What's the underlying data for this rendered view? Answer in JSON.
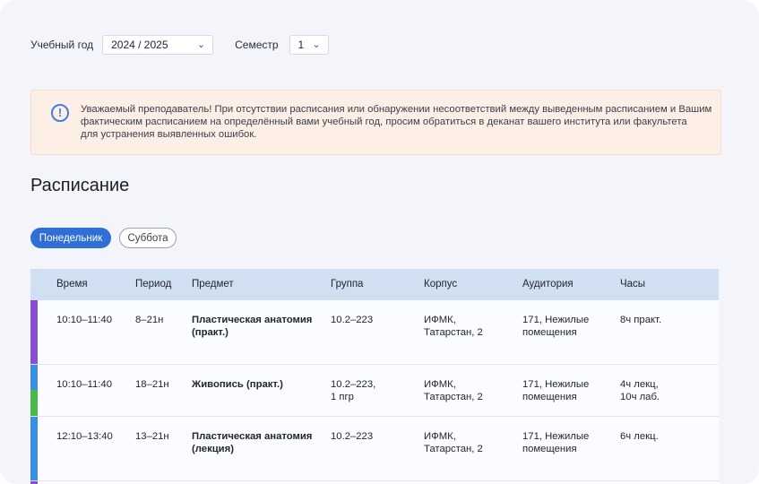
{
  "filters": {
    "year_label": "Учебный год",
    "year_value": "2024 / 2025",
    "semester_label": "Семестр",
    "semester_value": "1"
  },
  "alert": {
    "lines": [
      "Уважаемый преподаватель! При отсутствии расписания или обнаружении несоответствий между выведенным расписанием и Вашим",
      "фактическим расписанием на определённый вами учебный год, просим обратиться в деканат вашего института или факультета",
      "для устранения выявленных ошибок."
    ]
  },
  "title": "Расписание",
  "tabs": [
    {
      "label": "Понедельник",
      "active": true
    },
    {
      "label": "Суббота",
      "active": false
    }
  ],
  "table": {
    "headers": [
      "Время",
      "Период",
      "Предмет",
      "Группа",
      "Корпус",
      "Аудитория",
      "Часы"
    ],
    "rows": [
      {
        "time": "10:10–11:40",
        "period": "8–21н",
        "subject": [
          "Пластическая анатомия",
          "(практ.)"
        ],
        "group": [
          "10.2–223"
        ],
        "building": [
          "ИФМК,",
          "Татарстан, 2"
        ],
        "room": [
          "171, Нежилые",
          "помещения"
        ],
        "hours": [
          "8ч практ."
        ],
        "colors": [
          "#8a4fd0"
        ]
      },
      {
        "time": "10:10–11:40",
        "period": "18–21н",
        "subject": [
          "Живопись (практ.)"
        ],
        "group": [
          "10.2–223,",
          "1 пгр"
        ],
        "building": [
          "ИФМК,",
          "Татарстан, 2"
        ],
        "room": [
          "171, Нежилые",
          "помещения"
        ],
        "hours": [
          "4ч лекц,",
          "10ч лаб."
        ],
        "colors": [
          "#3c8fe0",
          "#4cb84a"
        ]
      },
      {
        "time": "12:10–13:40",
        "period": "13–21н",
        "subject": [
          "Пластическая анатомия",
          "(лекция)"
        ],
        "group": [
          "10.2–223"
        ],
        "building": [
          "ИФМК,",
          "Татарстан, 2"
        ],
        "room": [
          "171, Нежилые",
          "помещения"
        ],
        "hours": [
          "6ч лекц."
        ],
        "colors": [
          "#3c8fe0"
        ]
      }
    ]
  }
}
